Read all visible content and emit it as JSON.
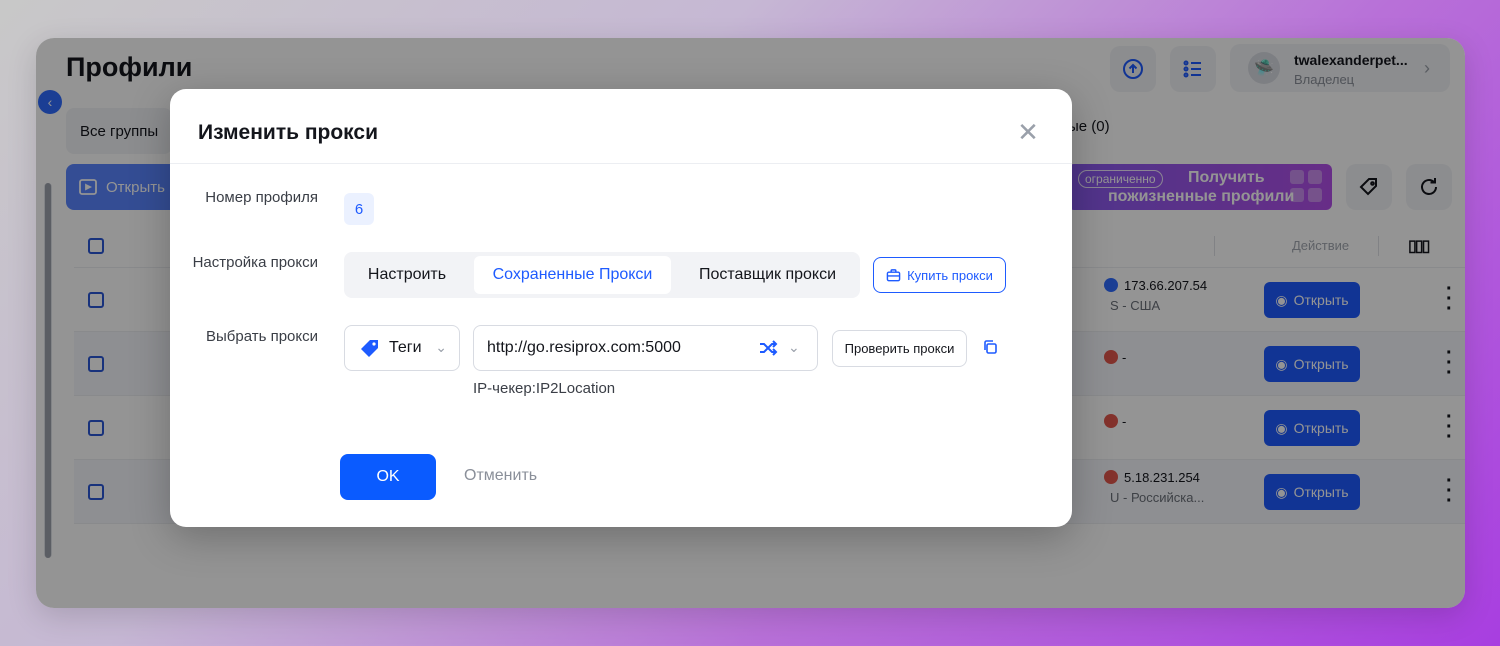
{
  "page": {
    "title": "Профили"
  },
  "user": {
    "name": "twalexanderpet...",
    "role": "Владелец"
  },
  "groups": {
    "all_label": "Все группы",
    "right_label": "ые (0)"
  },
  "toolbar": {
    "open_label": "Открыть"
  },
  "promo": {
    "badge": "ограниченно",
    "line1": "Получить",
    "line2": "пожизненные профили"
  },
  "table": {
    "action_header": "Действие",
    "open_label": "Открыть",
    "rows": [
      {
        "ip": "173.66.207.54",
        "location": "S - США",
        "dash": ""
      },
      {
        "ip": "",
        "location": "",
        "dash": "-"
      },
      {
        "ip": "",
        "location": "",
        "dash": "-"
      },
      {
        "ip": "5.18.231.254",
        "location": "U - Российска...",
        "dash": ""
      }
    ]
  },
  "modal": {
    "title": "Изменить прокси",
    "profile_number_label": "Номер профиля",
    "profile_number": "6",
    "proxy_setup_label": "Настройка прокси",
    "segments": [
      "Настроить",
      "Сохраненные Прокси",
      "Поставщик прокси"
    ],
    "active_segment": "Сохраненные Прокси",
    "buy_proxy_label": "Купить прокси",
    "select_proxy_label": "Выбрать прокси",
    "tags_label": "Теги",
    "proxy_value": "http://go.resiprox.com:5000",
    "check_proxy_label": "Проверить прокси",
    "ip_checker": "IP-чекер:IP2Location",
    "ok_label": "OK",
    "cancel_label": "Отменить"
  },
  "colors": {
    "accent": "#1e5bff",
    "ok_button": "#0a5bff",
    "overlay": "rgba(0,0,0,0.42)"
  },
  "icons": [
    "collapse-icon",
    "sync-icon",
    "list-icon",
    "avatar-icon",
    "chevron-right-icon",
    "browser-icon",
    "tag-icon",
    "refresh-icon",
    "columns-icon",
    "chrome-icon",
    "kebab-icon",
    "close-icon",
    "briefcase-icon",
    "shuffle-icon",
    "chevron-down-icon",
    "copy-icon"
  ]
}
